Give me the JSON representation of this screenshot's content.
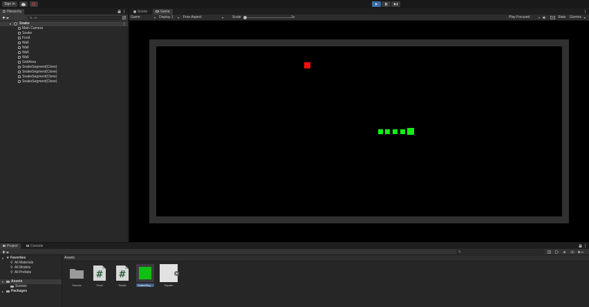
{
  "toolbar": {
    "sign_in": "Sign In",
    "play_state": "playing"
  },
  "hierarchy": {
    "tab_label": "Hierarchy",
    "search_placeholder": "All",
    "scene_name": "Snake",
    "items": [
      "Main Camera",
      "Snake",
      "Food",
      "Wall",
      "Wall",
      "Wall",
      "Wall",
      "GridArea",
      "SnakeSegment(Clone)",
      "SnakeSegment(Clone)",
      "SnakeSegment(Clone)",
      "SnakeSegment(Clone)"
    ]
  },
  "game_panel": {
    "tabs": [
      "Scene",
      "Game"
    ],
    "active_tab": "Game",
    "view_mode": "Game",
    "display": "Display 1",
    "aspect": "Free Aspect",
    "scale_label": "Scale",
    "scale_value": "1x",
    "play_mode": "Play Focused",
    "stats": "Stats",
    "gizmos": "Gizmos"
  },
  "game": {
    "colors": {
      "food": "#f10f0f",
      "snake": "#10f010",
      "wall": "#303030",
      "background": "#000000"
    }
  },
  "project_panel": {
    "tabs": [
      "Project",
      "Console"
    ],
    "favorites_label": "Favorites",
    "favorites": [
      "All Materials",
      "All Models",
      "All Prefabs"
    ],
    "assets_label": "Assets",
    "asset_folders": [
      "Scenes"
    ],
    "packages_label": "Packages",
    "breadcrumb": "Assets",
    "hidden_count": "20",
    "assets": [
      {
        "name": "Scenes",
        "kind": "folder-icon"
      },
      {
        "name": "Food",
        "kind": "csharp-script-icon"
      },
      {
        "name": "Snake",
        "kind": "csharp-script-icon"
      },
      {
        "name": "SnakeSeg...",
        "kind": "prefab-green-icon"
      },
      {
        "name": "Square",
        "kind": "sprite-icon"
      }
    ]
  }
}
